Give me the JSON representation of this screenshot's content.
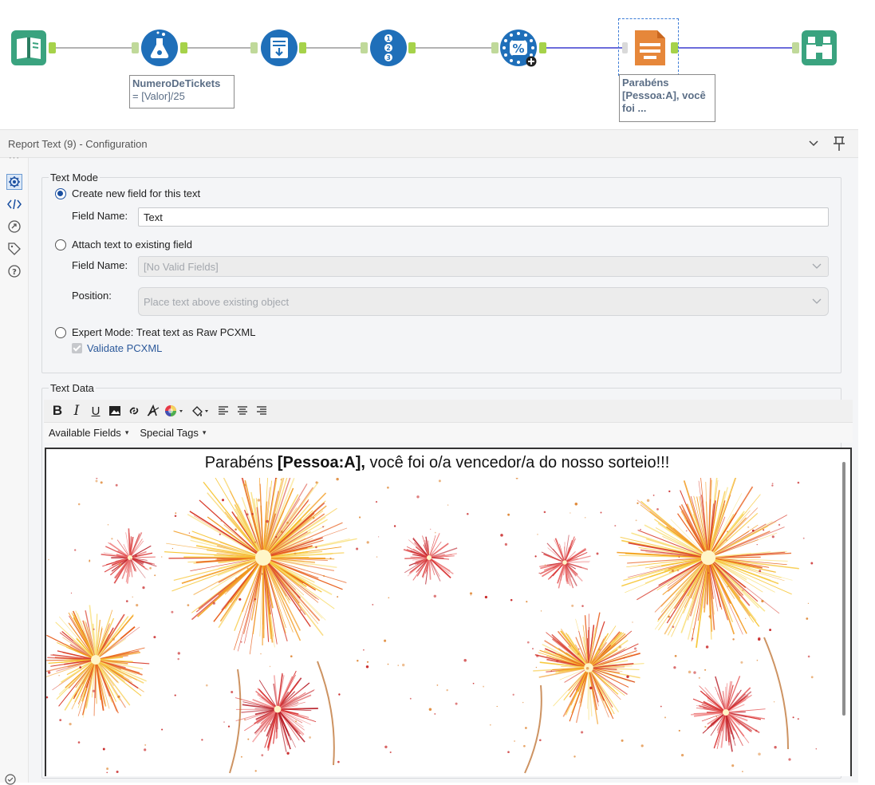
{
  "workflow": {
    "tools": [
      {
        "id": "input-data",
        "icon": "book-icon",
        "color": "#3aa37f"
      },
      {
        "id": "formula",
        "icon": "flask-icon",
        "color": "#1f6fb9"
      },
      {
        "id": "append-fields",
        "icon": "list-arrow-icon",
        "color": "#1f6fb9"
      },
      {
        "id": "record-id",
        "icon": "numbered-list-icon",
        "color": "#1f6fb9"
      },
      {
        "id": "random-sample",
        "icon": "percent-dots-icon",
        "color": "#1f6fb9"
      },
      {
        "id": "report-text",
        "icon": "document-lines-icon",
        "color": "#e6873a"
      },
      {
        "id": "browse",
        "icon": "binoculars-icon",
        "color": "#3aa37f"
      }
    ],
    "annotations": {
      "formula": {
        "line1": "NumeroDeTickets",
        "line2": "= [Valor]/25"
      },
      "report_text": {
        "line1": "Parabéns",
        "line2": "[Pessoa:A], você",
        "line3": "foi ..."
      }
    }
  },
  "panel": {
    "title": "Report Text (9) - Configuration"
  },
  "text_mode": {
    "legend": "Text Mode",
    "option_create": "Create new field for this text",
    "field_name_label": "Field Name:",
    "field_name_value": "Text",
    "option_attach": "Attach text to existing field",
    "attach_field_label": "Field Name:",
    "attach_field_value": "[No Valid Fields]",
    "position_label": "Position:",
    "position_value": "Place text above existing object",
    "option_expert": "Expert Mode: Treat text as Raw PCXML",
    "validate_label": "Validate PCXML"
  },
  "text_data": {
    "legend": "Text Data",
    "toolbar": {
      "bold": "B",
      "italic": "I",
      "underline": "U"
    },
    "available_fields": "Available Fields",
    "special_tags": "Special Tags",
    "content_prefix": "Parabéns ",
    "content_bold": "[Pessoa:A],",
    "content_suffix": " você foi o/a vencedor/a do nosso sorteio!!!"
  }
}
